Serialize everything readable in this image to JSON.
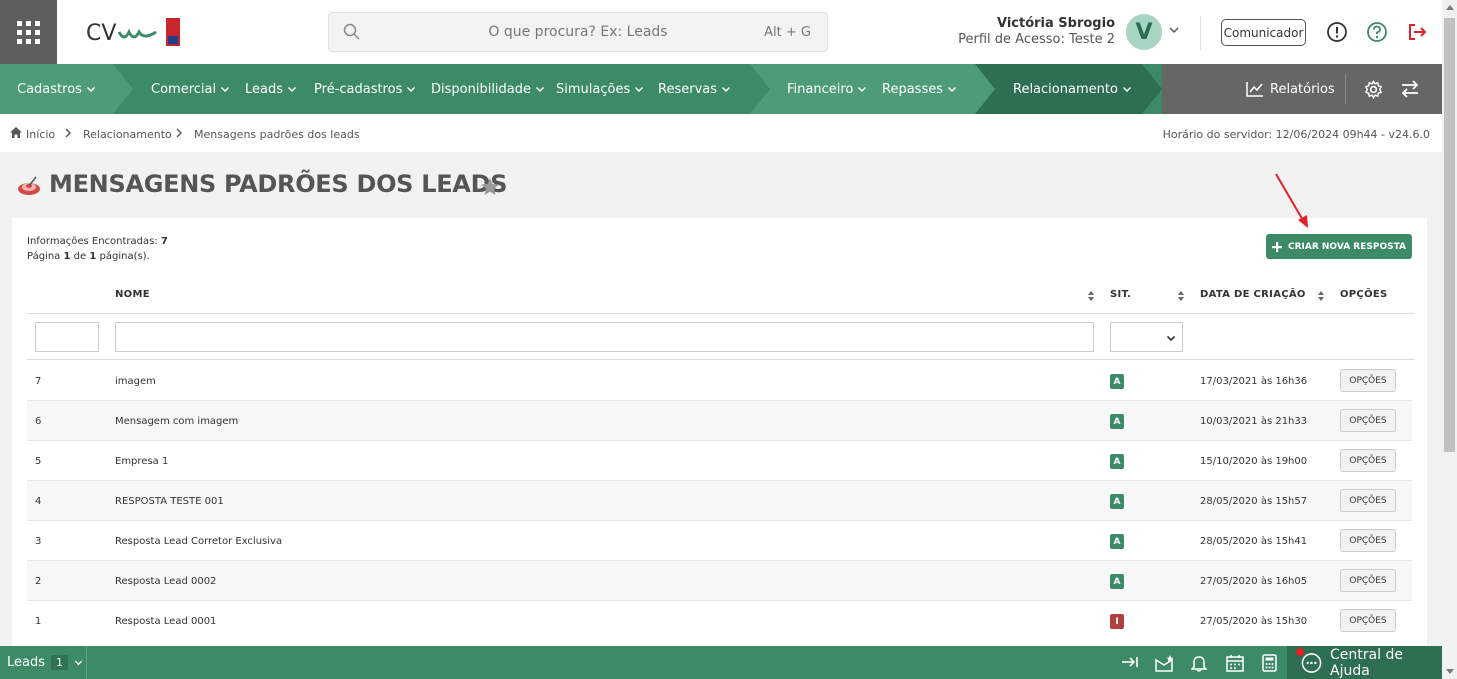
{
  "header": {
    "logo_text": "CV",
    "search_placeholder": "O que procura? Ex: Leads",
    "search_shortcut": "Alt + G",
    "user_name": "Victória Sbrogio",
    "user_profile": "Perfil de Acesso: Teste 2",
    "avatar_letter": "V",
    "communicator_label": "Comunicador"
  },
  "nav": {
    "items": [
      "Cadastros",
      "Comercial",
      "Leads",
      "Pré-cadastros",
      "Disponibilidade",
      "Simulações",
      "Reservas",
      "Financeiro",
      "Repasses",
      "Relacionamento"
    ],
    "reports_label": "Relatórios",
    "colors": {
      "primary": "#3d8a67",
      "light": "#4e9b78",
      "dark": "#2e6e51",
      "gray": "#666666"
    }
  },
  "breadcrumb": {
    "home": "Início",
    "level1": "Relacionamento",
    "level2": "Mensagens padrões dos leads",
    "server_time": "Horário do servidor: 12/06/2024 09h44 - v24.6.0"
  },
  "page": {
    "title": "MENSAGENS PADRÕES DOS LEADS",
    "info_label": "Informações Encontradas:",
    "info_count": "7",
    "page_word": "Página",
    "page_current": "1",
    "page_of": "de",
    "page_total": "1",
    "page_suffix": "página(s).",
    "new_button": "CRIAR NOVA RESPOSTA"
  },
  "table": {
    "headers": {
      "name": "NOME",
      "status": "SIT.",
      "created": "DATA DE CRIAÇÃO",
      "options": "OPÇÕES"
    },
    "rows": [
      {
        "id": "7",
        "name": "imagem",
        "status": "A",
        "created": "17/03/2021 às 16h36",
        "options": "OPÇÕES"
      },
      {
        "id": "6",
        "name": "Mensagem com imagem",
        "status": "A",
        "created": "10/03/2021 às 21h33",
        "options": "OPÇÕES"
      },
      {
        "id": "5",
        "name": "Empresa 1",
        "status": "A",
        "created": "15/10/2020 às 19h00",
        "options": "OPÇÕES"
      },
      {
        "id": "4",
        "name": "RESPOSTA TESTE 001",
        "status": "A",
        "created": "28/05/2020 às 15h57",
        "options": "OPÇÕES"
      },
      {
        "id": "3",
        "name": "Resposta Lead Corretor Exclusiva",
        "status": "A",
        "created": "28/05/2020 às 15h41",
        "options": "OPÇÕES"
      },
      {
        "id": "2",
        "name": "Resposta Lead 0002",
        "status": "A",
        "created": "27/05/2020 às 16h05",
        "options": "OPÇÕES"
      },
      {
        "id": "1",
        "name": "Resposta Lead 0001",
        "status": "I",
        "created": "27/05/2020 às 15h30",
        "options": "OPÇÕES"
      }
    ]
  },
  "footer": {
    "module": "Leads",
    "count": "1",
    "help_label": "Central de Ajuda"
  }
}
